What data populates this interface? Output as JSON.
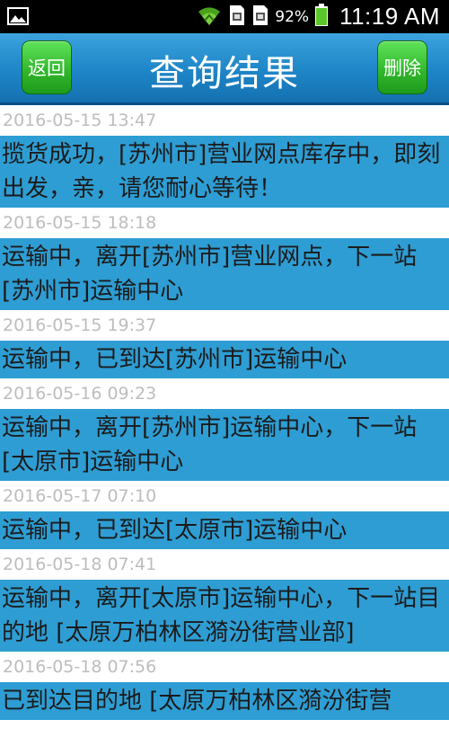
{
  "status_bar": {
    "battery_percent": "92%",
    "time": "11:19 AM",
    "icons": [
      "image-icon",
      "wifi-icon",
      "sim1-icon",
      "sim2-icon",
      "battery-icon"
    ]
  },
  "header": {
    "title": "查询结果",
    "back_label": "返回",
    "delete_label": "删除"
  },
  "colors": {
    "header": "#1e85c7",
    "button": "#2fb52a",
    "message_bg": "#2e9dd3",
    "timestamp": "#bdbdbd"
  },
  "entries": [
    {
      "time": "2016-05-15 13:47",
      "message": "揽货成功，[苏州市]营业网点库存中，即刻出发，亲，请您耐心等待！"
    },
    {
      "time": "2016-05-15 18:18",
      "message": "运输中，离开[苏州市]营业网点，下一站[苏州市]运输中心"
    },
    {
      "time": "2016-05-15 19:37",
      "message": "运输中，已到达[苏州市]运输中心"
    },
    {
      "time": "2016-05-16 09:23",
      "message": "运输中，离开[苏州市]运输中心，下一站[太原市]运输中心"
    },
    {
      "time": "2016-05-17 07:10",
      "message": "运输中，已到达[太原市]运输中心"
    },
    {
      "time": "2016-05-18 07:41",
      "message": "运输中，离开[太原市]运输中心，下一站目的地 [太原万柏林区漪汾街营业部]"
    },
    {
      "time": "2016-05-18 07:56",
      "message": "已到达目的地 [太原万柏林区漪汾街营"
    }
  ]
}
